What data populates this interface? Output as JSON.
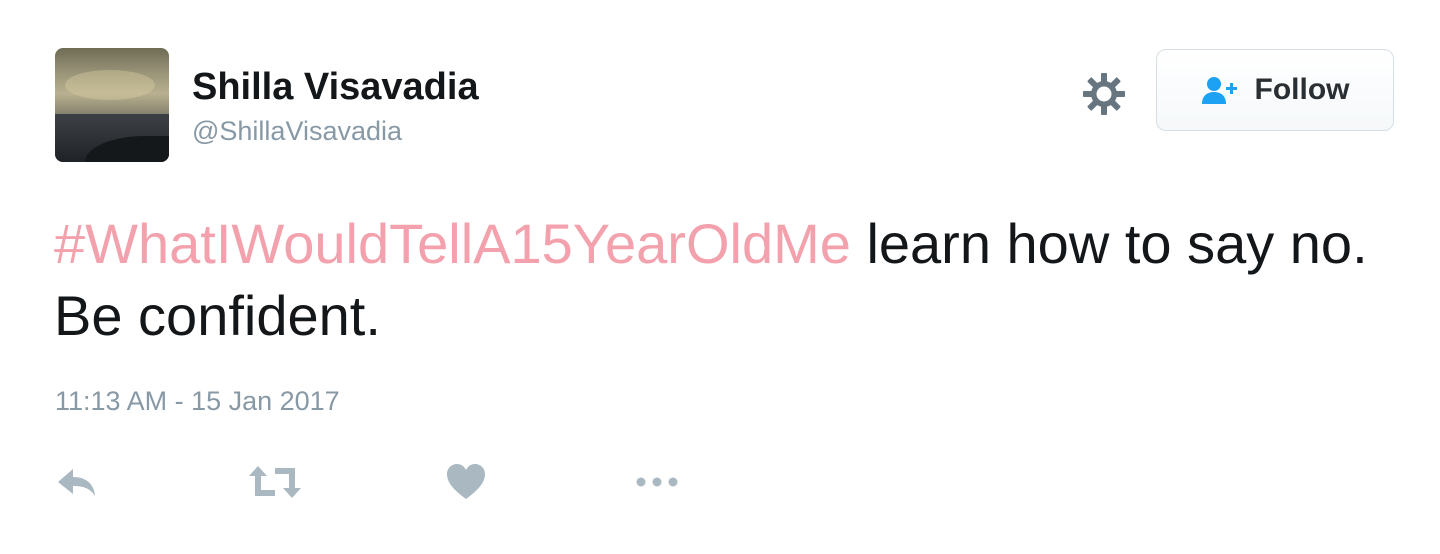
{
  "user": {
    "display_name": "Shilla Visavadia",
    "handle": "@ShillaVisavadia",
    "avatar_icon": "profile-photo-sunset"
  },
  "header_actions": {
    "gear_icon": "gear-icon",
    "follow_label": "Follow",
    "follow_icon": "user-plus-icon"
  },
  "tweet": {
    "hashtag": "#WhatIWouldTellA15YearOldMe",
    "text": " learn how to say no. Be confident.",
    "timestamp": "11:13 AM - 15 Jan 2017"
  },
  "actions": [
    {
      "icon": "reply-icon"
    },
    {
      "icon": "retweet-icon"
    },
    {
      "icon": "heart-icon"
    },
    {
      "icon": "more-icon"
    }
  ],
  "colors": {
    "hashtag": "#f2a1ad",
    "accent": "#1da1f2",
    "muted": "#8899a6",
    "icon": "#aab8c2",
    "text": "#14171a"
  }
}
